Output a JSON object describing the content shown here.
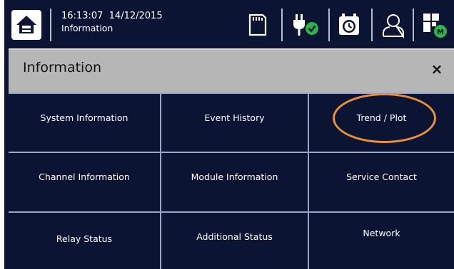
{
  "status_bar": {
    "time": "16:13:07",
    "date": "14/12/2015",
    "subtitle": "Information",
    "icons": [
      "home-icon",
      "sd-card-icon",
      "power-ok-icon",
      "timer-clock-icon",
      "user-icon",
      "module-status-icon"
    ],
    "module_badge": "M"
  },
  "dialog": {
    "title": "Information",
    "close_label": "×"
  },
  "menu": {
    "items": [
      {
        "label": "System Information"
      },
      {
        "label": "Event History"
      },
      {
        "label": "Trend / Plot"
      },
      {
        "label": "Channel Information"
      },
      {
        "label": "Module Information"
      },
      {
        "label": "Service Contact"
      },
      {
        "label": "Relay Status"
      },
      {
        "label": "Additional Status"
      },
      {
        "label": "Network"
      }
    ]
  },
  "colors": {
    "background": "#0c1433",
    "header": "#b6b6b6",
    "highlight": "#e8913a",
    "status_ok": "#2db34a"
  }
}
